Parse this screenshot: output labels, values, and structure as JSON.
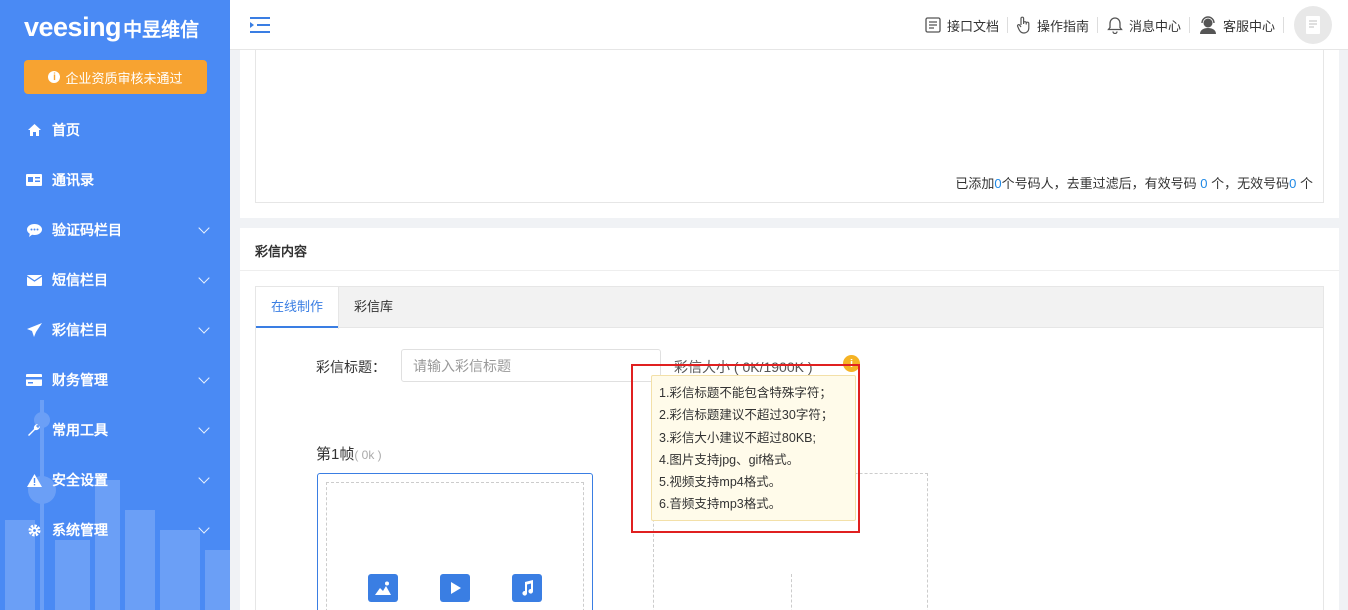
{
  "sidebar": {
    "logo_en": "veesing",
    "logo_cn": "中昱维信",
    "warning_button": "企业资质审核未通过",
    "items": [
      {
        "label": "首页",
        "icon": "home-icon",
        "has_children": false
      },
      {
        "label": "通讯录",
        "icon": "contacts-icon",
        "has_children": false
      },
      {
        "label": "验证码栏目",
        "icon": "chat-icon",
        "has_children": true
      },
      {
        "label": "短信栏目",
        "icon": "mail-icon",
        "has_children": true
      },
      {
        "label": "彩信栏目",
        "icon": "send-icon",
        "has_children": true
      },
      {
        "label": "财务管理",
        "icon": "card-icon",
        "has_children": true
      },
      {
        "label": "常用工具",
        "icon": "wrench-icon",
        "has_children": true
      },
      {
        "label": "安全设置",
        "icon": "warning-icon",
        "has_children": true
      },
      {
        "label": "系统管理",
        "icon": "gear-icon",
        "has_children": true
      }
    ]
  },
  "header": {
    "links": [
      {
        "label": "接口文档",
        "icon": "document-icon"
      },
      {
        "label": "操作指南",
        "icon": "hand-pointer-icon"
      },
      {
        "label": "消息中心",
        "icon": "bell-icon"
      },
      {
        "label": "客服中心",
        "icon": "support-agent-icon"
      }
    ]
  },
  "recipients": {
    "t1": "已添加",
    "added": "0",
    "t2": "个号码人，去重过滤后，有效号码 ",
    "valid": "0",
    "t3": " 个，无效号码",
    "invalid": "0",
    "t4": " 个"
  },
  "mms": {
    "section_title": "彩信内容",
    "tabs": [
      "在线制作",
      "彩信库"
    ],
    "title_label": "彩信标题：",
    "title_placeholder": "请输入彩信标题",
    "size_label": "彩信大小 ( 0K/1900K )",
    "frame_label": "第1帧",
    "frame_size": "( 0k )",
    "tips": [
      "1.彩信标题不能包含特殊字符；",
      "2.彩信标题建议不超过30字符；",
      "3.彩信大小建议不超过80KB;",
      "4.图片支持jpg、gif格式。",
      "5.视频支持mp4格式。",
      "6.音频支持mp3格式。"
    ]
  },
  "colors": {
    "sidebar": "#4a8af4",
    "accent": "#3a7ee3",
    "warning": "#f7a331",
    "highlight": "#e02020"
  }
}
